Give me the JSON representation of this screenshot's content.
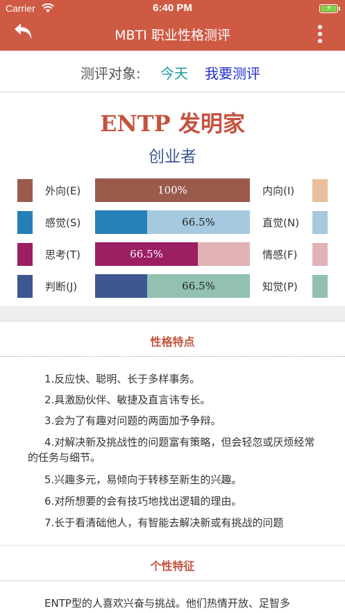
{
  "status_bar": {
    "carrier": "Carrier",
    "time": "6:40 PM"
  },
  "nav": {
    "title": "MBTI 职业性格测评"
  },
  "subject": {
    "label": "测评对象:",
    "today": "今天",
    "test": "我要测评"
  },
  "result": {
    "type_title": "ENTP 发明家",
    "type_subtitle": "创业者"
  },
  "dimensions": [
    {
      "left_label": "外向(E)",
      "right_label": "内向(I)",
      "left_color": "#9a5b4d",
      "right_color": "#e8bf9a",
      "percent": 100,
      "percent_text": "100%",
      "dominant": "left"
    },
    {
      "left_label": "感觉(S)",
      "right_label": "直觉(N)",
      "left_color": "#2680b8",
      "right_color": "#a6c9df",
      "percent": 66.5,
      "percent_text": "66.5%",
      "dominant": "right"
    },
    {
      "left_label": "思考(T)",
      "right_label": "情感(F)",
      "left_color": "#9c1e63",
      "right_color": "#e0b2b4",
      "percent": 66.5,
      "percent_text": "66.5%",
      "dominant": "left"
    },
    {
      "left_label": "判断(J)",
      "right_label": "知觉(P)",
      "left_color": "#3e5692",
      "right_color": "#92c1b2",
      "percent": 66.5,
      "percent_text": "66.5%",
      "dominant": "right"
    }
  ],
  "traits_section": {
    "heading": "性格特点",
    "items": [
      "1.反应快、聪明、长于多样事务。",
      "2.具激励伙伴、敏捷及直言讳专长。",
      "3.会为了有趣对问题的两面加予争辩。",
      "4.对解决新及挑战性的问题富有策略，但会轻忽或厌烦经常的任务与细节。",
      "5.兴趣多元，易倾向于转移至新生的兴趣。",
      "6.对所想要的会有技巧地找出逻辑的理由。",
      "7.长于看清础他人，有智能去解决新或有挑战的问题"
    ]
  },
  "personality_section": {
    "heading": "个性特征",
    "paragraph": "ENTP型的人喜欢兴奋与挑战。他们热情开放、足智多"
  },
  "colors": {
    "accent": "#cf5a44",
    "heading": "#c5523e",
    "subtitle": "#3d5a94"
  }
}
